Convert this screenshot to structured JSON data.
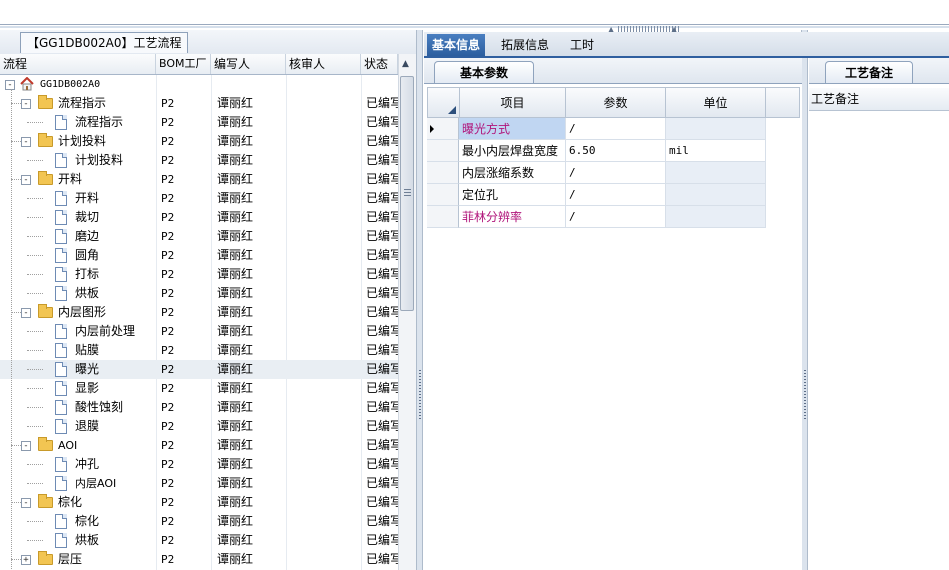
{
  "left_panel": {
    "tab_title": "【GG1DB002A0】工艺流程",
    "columns": [
      "流程",
      "BOM工厂",
      "编写人",
      "核审人",
      "状态"
    ],
    "rows": [
      {
        "name": "GG1DB002A0",
        "level": 0,
        "type": "root",
        "expander": "-",
        "bom": "",
        "writer": "",
        "status": ""
      },
      {
        "name": "流程指示",
        "level": 1,
        "type": "folder",
        "expander": "-",
        "bom": "P2",
        "writer": "谭丽红",
        "status": "已编写"
      },
      {
        "name": "流程指示",
        "level": 2,
        "type": "doc",
        "bom": "P2",
        "writer": "谭丽红",
        "status": "已编写"
      },
      {
        "name": "计划投料",
        "level": 1,
        "type": "folder",
        "expander": "-",
        "bom": "P2",
        "writer": "谭丽红",
        "status": "已编写"
      },
      {
        "name": "计划投料",
        "level": 2,
        "type": "doc",
        "bom": "P2",
        "writer": "谭丽红",
        "status": "已编写"
      },
      {
        "name": "开料",
        "level": 1,
        "type": "folder",
        "expander": "-",
        "bom": "P2",
        "writer": "谭丽红",
        "status": "已编写"
      },
      {
        "name": "开料",
        "level": 2,
        "type": "doc",
        "bom": "P2",
        "writer": "谭丽红",
        "status": "已编写"
      },
      {
        "name": "裁切",
        "level": 2,
        "type": "doc",
        "bom": "P2",
        "writer": "谭丽红",
        "status": "已编写"
      },
      {
        "name": "磨边",
        "level": 2,
        "type": "doc",
        "bom": "P2",
        "writer": "谭丽红",
        "status": "已编写"
      },
      {
        "name": "圆角",
        "level": 2,
        "type": "doc",
        "bom": "P2",
        "writer": "谭丽红",
        "status": "已编写"
      },
      {
        "name": "打标",
        "level": 2,
        "type": "doc",
        "bom": "P2",
        "writer": "谭丽红",
        "status": "已编写"
      },
      {
        "name": "烘板",
        "level": 2,
        "type": "doc",
        "bom": "P2",
        "writer": "谭丽红",
        "status": "已编写"
      },
      {
        "name": "内层图形",
        "level": 1,
        "type": "folder",
        "expander": "-",
        "bom": "P2",
        "writer": "谭丽红",
        "status": "已编写"
      },
      {
        "name": "内层前处理",
        "level": 2,
        "type": "doc",
        "bom": "P2",
        "writer": "谭丽红",
        "status": "已编写"
      },
      {
        "name": "贴膜",
        "level": 2,
        "type": "doc",
        "bom": "P2",
        "writer": "谭丽红",
        "status": "已编写"
      },
      {
        "name": "曝光",
        "level": 2,
        "type": "doc",
        "bom": "P2",
        "writer": "谭丽红",
        "status": "已编写",
        "selected": true
      },
      {
        "name": "显影",
        "level": 2,
        "type": "doc",
        "bom": "P2",
        "writer": "谭丽红",
        "status": "已编写"
      },
      {
        "name": "酸性蚀刻",
        "level": 2,
        "type": "doc",
        "bom": "P2",
        "writer": "谭丽红",
        "status": "已编写"
      },
      {
        "name": "退膜",
        "level": 2,
        "type": "doc",
        "bom": "P2",
        "writer": "谭丽红",
        "status": "已编写"
      },
      {
        "name": "AOI",
        "level": 1,
        "type": "folder",
        "expander": "-",
        "bom": "P2",
        "writer": "谭丽红",
        "status": "已编写"
      },
      {
        "name": "冲孔",
        "level": 2,
        "type": "doc",
        "bom": "P2",
        "writer": "谭丽红",
        "status": "已编写"
      },
      {
        "name": "内层AOI",
        "level": 2,
        "type": "doc",
        "bom": "P2",
        "writer": "谭丽红",
        "status": "已编写"
      },
      {
        "name": "棕化",
        "level": 1,
        "type": "folder",
        "expander": "-",
        "bom": "P2",
        "writer": "谭丽红",
        "status": "已编写"
      },
      {
        "name": "棕化",
        "level": 2,
        "type": "doc",
        "bom": "P2",
        "writer": "谭丽红",
        "status": "已编写"
      },
      {
        "name": "烘板",
        "level": 2,
        "type": "doc",
        "bom": "P2",
        "writer": "谭丽红",
        "status": "已编写"
      },
      {
        "name": "层压",
        "level": 1,
        "type": "folder",
        "expander": "+",
        "bom": "P2",
        "writer": "谭丽红",
        "status": "已编写"
      }
    ]
  },
  "middle_panel": {
    "tabs": [
      "基本信息",
      "拓展信息",
      "工时"
    ],
    "active_tab": 0,
    "subtab": "基本参数",
    "columns": [
      "项目",
      "参数",
      "单位"
    ],
    "params": [
      {
        "item": "曝光方式",
        "value": "/",
        "unit": "",
        "pink": true,
        "current": true
      },
      {
        "item": "最小内层焊盘宽度",
        "value": "6.50",
        "unit": "mil",
        "pink": false
      },
      {
        "item": "内层涨缩系数",
        "value": "/",
        "unit": "",
        "pink": false
      },
      {
        "item": "定位孔",
        "value": "/",
        "unit": "",
        "pink": false
      },
      {
        "item": "菲林分辨率",
        "value": "/",
        "unit": "",
        "pink": true
      }
    ]
  },
  "right_panel": {
    "tab": "工艺备注",
    "header": "工艺备注"
  },
  "colors": {
    "active_tab_bg": "#2c5e9e",
    "highlight_text": "#b0147a",
    "selected_cell": "#c0d6f2"
  }
}
